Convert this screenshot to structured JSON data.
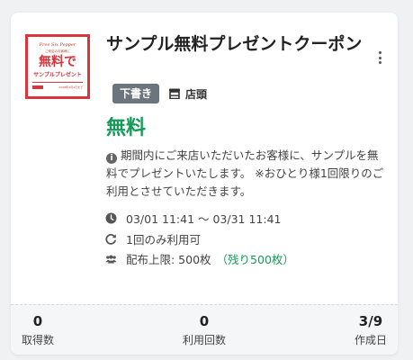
{
  "coupon": {
    "title": "サンプル無料プレゼントクーポン",
    "status_badge": "下書き",
    "store_label": "店頭",
    "price": "無料",
    "description": "期間内にご来店いただいたお客様に、サンプルを無料でプレゼントいたします。 ※おひとり様1回限りのご利用とさせていただきます。",
    "period": "03/01 11:41 〜 03/31 11:41",
    "usage": "1回のみ利用可",
    "limit": "配布上限: 500枚",
    "remaining": "（残り500枚）"
  },
  "thumbnail": {
    "script_text": "Free Six Pepper",
    "small_text": "ご来店のお客様に",
    "big_text": "無料で",
    "mid_text": "サンプルプレゼント",
    "date_text": "2018年4月1日まで"
  },
  "stats": [
    {
      "value": "0",
      "label": "取得数"
    },
    {
      "value": "0",
      "label": "利用回数"
    },
    {
      "value": "3/9",
      "label": "作成日"
    }
  ],
  "colors": {
    "accent_green": "#159a58",
    "badge_gray": "#6c757d",
    "thumb_red": "#d8363c"
  },
  "icons": {
    "menu": "kebab-menu-icon",
    "store": "store-icon",
    "info": "info-icon",
    "clock": "clock-icon",
    "usage": "redo-icon",
    "users": "users-icon"
  }
}
